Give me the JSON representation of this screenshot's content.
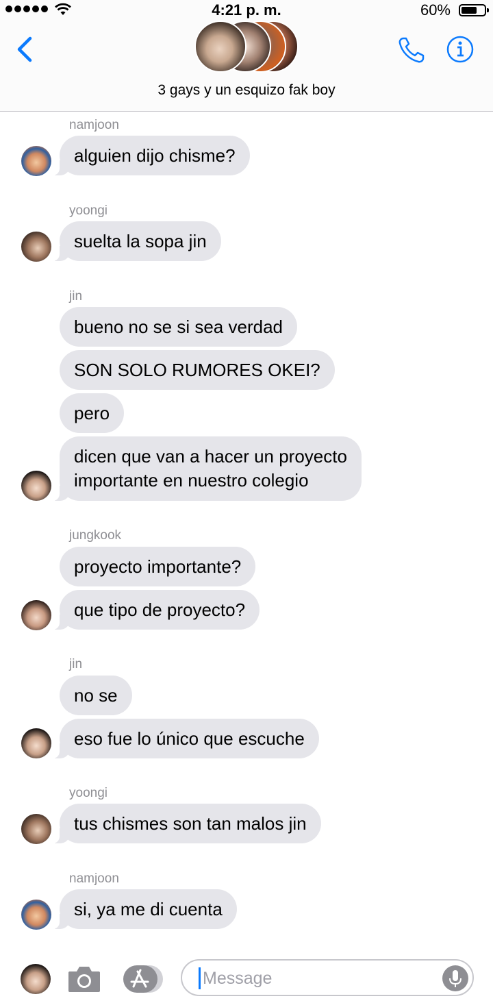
{
  "status_bar": {
    "time": "4:21 p. m.",
    "battery": "60%"
  },
  "header": {
    "group_name": "3 gays y un esquizo fak boy"
  },
  "messages": [
    {
      "sender": "namjoon",
      "bubbles": [
        "alguien dijo chisme?"
      ]
    },
    {
      "sender": "yoongi",
      "bubbles": [
        "suelta la sopa jin"
      ]
    },
    {
      "sender": "jin",
      "bubbles": [
        "bueno no se si sea verdad",
        "SON SOLO RUMORES OKEI?",
        "pero",
        "dicen que van a hacer un proyecto",
        "importante en nuestro colegio"
      ]
    },
    {
      "sender": "jungkook",
      "bubbles": [
        "proyecto importante?",
        "que tipo de proyecto?"
      ]
    },
    {
      "sender": "jin",
      "bubbles": [
        "no se",
        "eso fue lo único que escuche"
      ]
    },
    {
      "sender": "yoongi",
      "bubbles": [
        "tus chismes son tan malos jin"
      ]
    },
    {
      "sender": "namjoon",
      "bubbles": [
        "si, ya me di cuenta"
      ]
    }
  ],
  "input": {
    "placeholder": "Message"
  },
  "colors": {
    "accent": "#0b7afd",
    "bubble_received": "#e5e5ea",
    "sender_name": "#8e8e93"
  },
  "icons": [
    "signal-icon",
    "wifi-icon",
    "battery-icon",
    "back-chevron-icon",
    "phone-icon",
    "info-icon",
    "camera-icon",
    "app-store-icon",
    "mic-icon"
  ]
}
